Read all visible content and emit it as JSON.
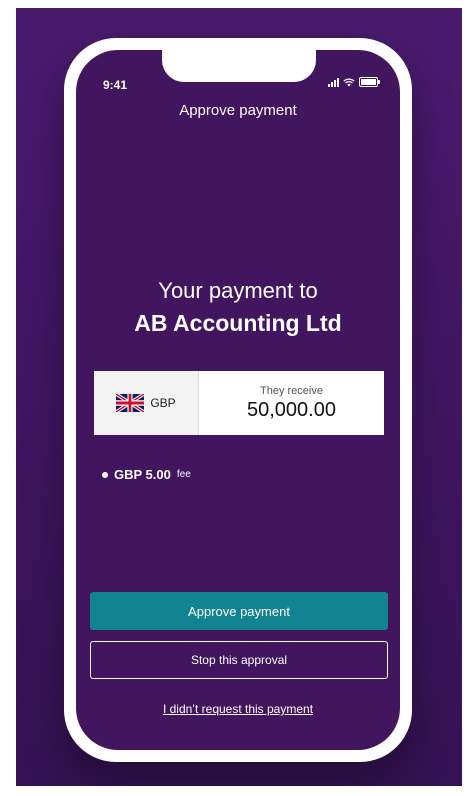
{
  "status_bar": {
    "time": "9:41",
    "icons": [
      "signal-icon",
      "wifi-icon",
      "battery-icon"
    ]
  },
  "header": {
    "title": "Approve payment"
  },
  "payment": {
    "heading_line1": "Your payment to",
    "payee": "AB Accounting Ltd",
    "currency_flag": "uk-flag-icon",
    "currency_code": "GBP",
    "receive_label": "They receive",
    "receive_amount": "50,000.00",
    "fee_amount": "GBP 5.00",
    "fee_suffix": "fee"
  },
  "actions": {
    "approve_label": "Approve payment",
    "stop_label": "Stop this approval",
    "didnt_request_label": "I didn’t request this payment"
  },
  "colors": {
    "background": "#4a1a6e",
    "screen": "#42155f",
    "approve_button": "#128390",
    "frame": "#ffffff"
  }
}
